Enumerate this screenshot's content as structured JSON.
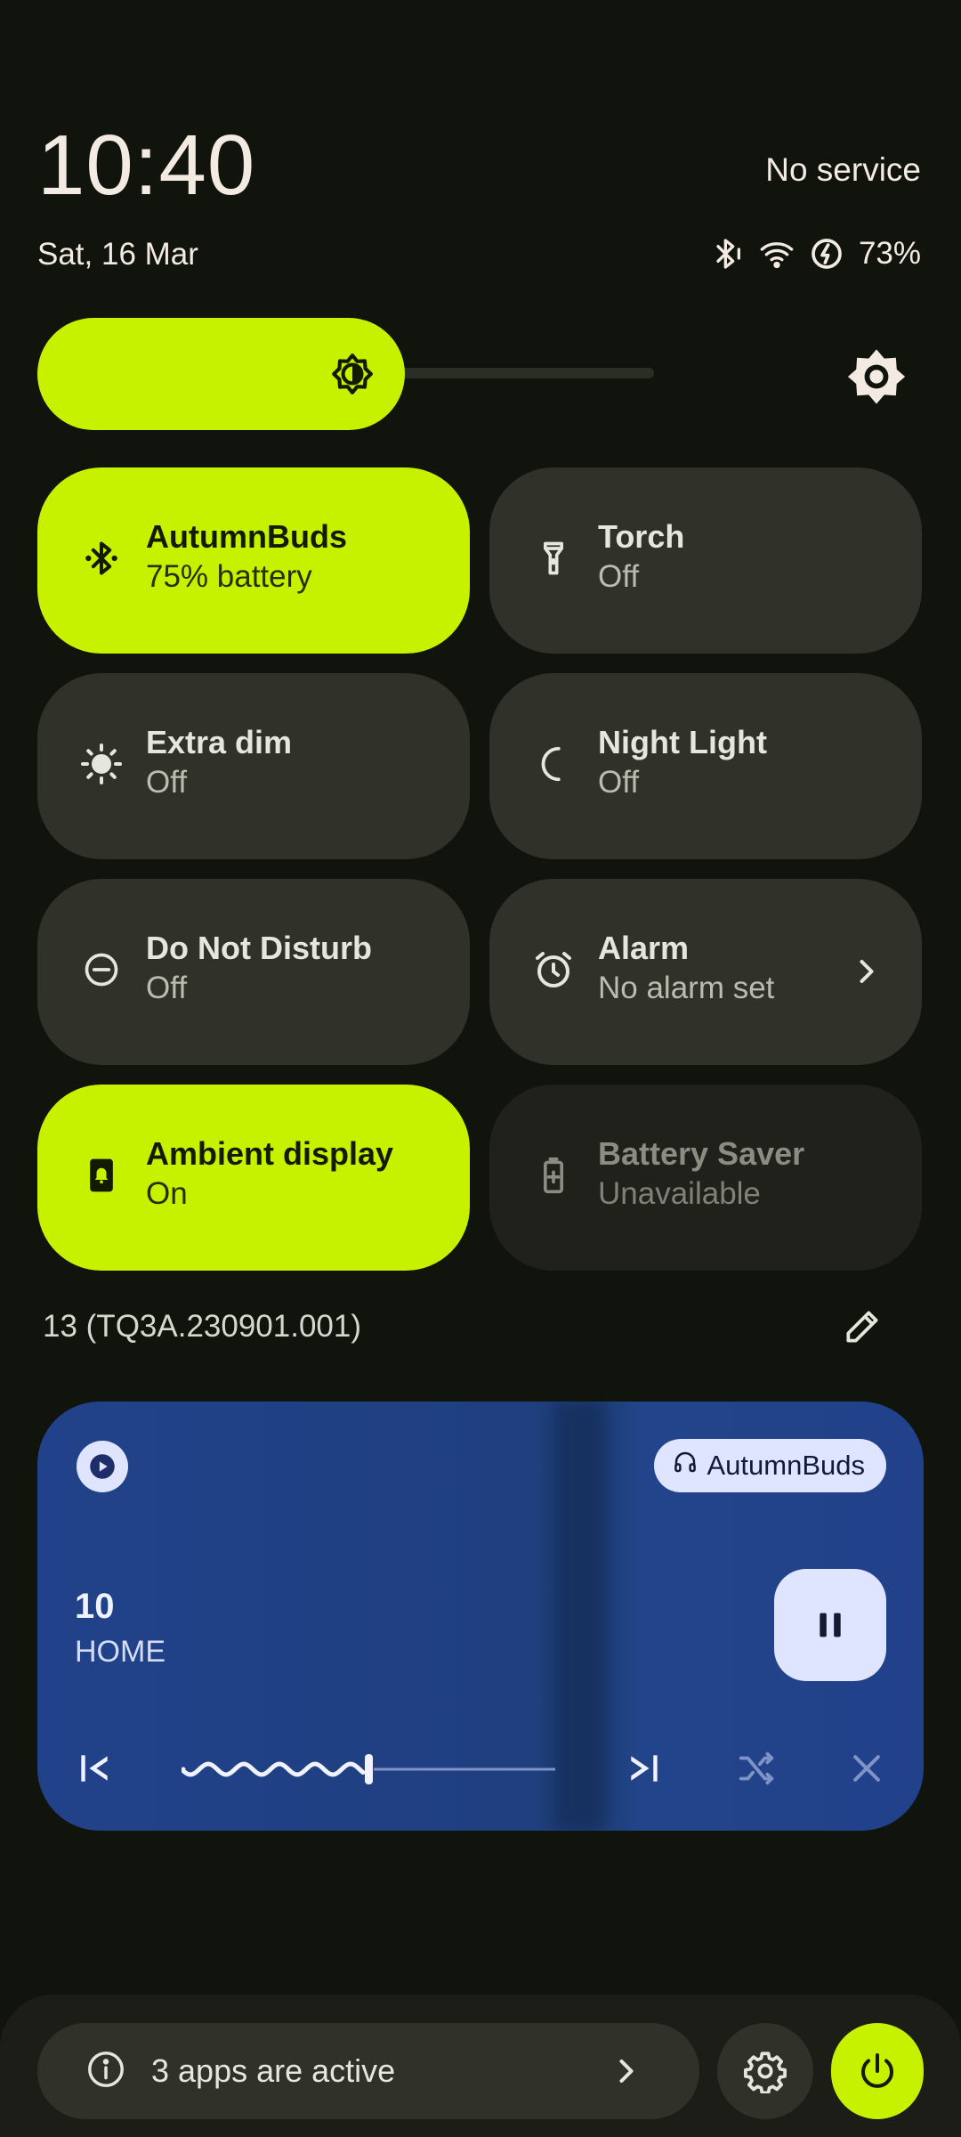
{
  "status": {
    "time": "10:40",
    "date": "Sat, 16 Mar",
    "carrier": "No service",
    "battery_percent": "73%",
    "icons": [
      "bluetooth-connected-icon",
      "wifi-icon",
      "battery-charging-icon"
    ]
  },
  "brightness": {
    "level_fraction": 0.49,
    "icon": "brightness-icon",
    "auto_icon": "auto-brightness-icon"
  },
  "tiles": [
    {
      "title": "AutumnBuds",
      "subtitle": "75% battery",
      "state": "on",
      "icon": "bluetooth-icon"
    },
    {
      "title": "Torch",
      "subtitle": "Off",
      "state": "off",
      "icon": "flashlight-icon"
    },
    {
      "title": "Extra dim",
      "subtitle": "Off",
      "state": "off",
      "icon": "sun-icon"
    },
    {
      "title": "Night Light",
      "subtitle": "Off",
      "state": "off",
      "icon": "moon-icon"
    },
    {
      "title": "Do Not Disturb",
      "subtitle": "Off",
      "state": "off",
      "icon": "do-not-disturb-icon"
    },
    {
      "title": "Alarm",
      "subtitle": "No alarm set",
      "state": "off",
      "icon": "alarm-icon"
    },
    {
      "title": "Ambient display",
      "subtitle": "On",
      "state": "on",
      "icon": "ambient-display-icon"
    },
    {
      "title": "Battery Saver",
      "subtitle": "Unavailable",
      "state": "unavailable",
      "icon": "battery-saver-icon"
    }
  ],
  "build_number": "13 (TQ3A.230901.001)",
  "media": {
    "output_device": "AutumnBuds",
    "title": "10",
    "artist": "HOME",
    "progress_fraction": 0.5
  },
  "footer": {
    "active_apps_label": "3 apps are active"
  },
  "colors": {
    "accent": "#c6f200",
    "tile_off": "#30322a",
    "background": "#11130d",
    "media_bg": "#21428a"
  }
}
